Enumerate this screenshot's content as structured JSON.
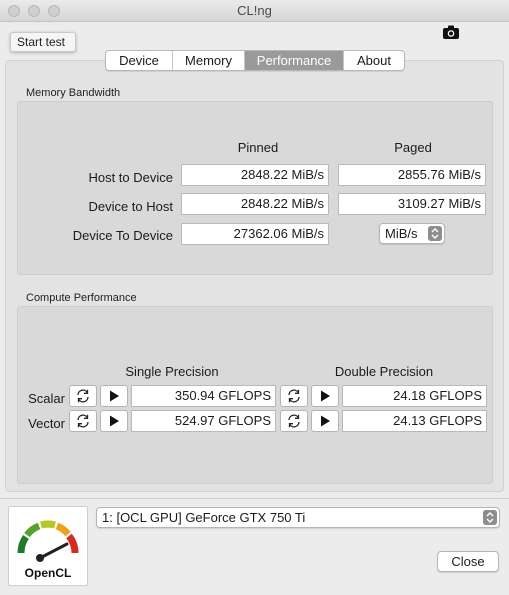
{
  "window": {
    "title": "CL!ng"
  },
  "tooltip": {
    "text": "Start test"
  },
  "icons": {
    "camera": "camera-icon",
    "refresh": "refresh-icon",
    "play": "play-icon",
    "opencl": "opencl-logo"
  },
  "tabs": [
    {
      "label": "Device"
    },
    {
      "label": "Memory"
    },
    {
      "label": "Performance"
    },
    {
      "label": "About"
    }
  ],
  "memory_bandwidth": {
    "title": "Memory Bandwidth",
    "col_pinned": "Pinned",
    "col_paged": "Paged",
    "rows": [
      {
        "label": "Host to Device",
        "pinned": "2848.22 MiB/s",
        "paged": "2855.76 MiB/s"
      },
      {
        "label": "Device to Host",
        "pinned": "2848.22 MiB/s",
        "paged": "3109.27 MiB/s"
      },
      {
        "label": "Device To Device",
        "pinned": "27362.06 MiB/s"
      }
    ],
    "unit_select": "MiB/s"
  },
  "compute_performance": {
    "title": "Compute Performance",
    "col_single": "Single Precision",
    "col_double": "Double Precision",
    "rows": [
      {
        "label": "Scalar",
        "single": "350.94 GFLOPS",
        "double": "24.18 GFLOPS"
      },
      {
        "label": "Vector",
        "single": "524.97 GFLOPS",
        "double": "24.13 GFLOPS"
      }
    ]
  },
  "device_select": {
    "value": "1: [OCL GPU] GeForce GTX 750 Ti"
  },
  "logo": {
    "text": "OpenCL"
  },
  "close_button": {
    "label": "Close"
  },
  "colors": {
    "active_tab": "#9a9a9a",
    "window_bg": "#ececec"
  }
}
